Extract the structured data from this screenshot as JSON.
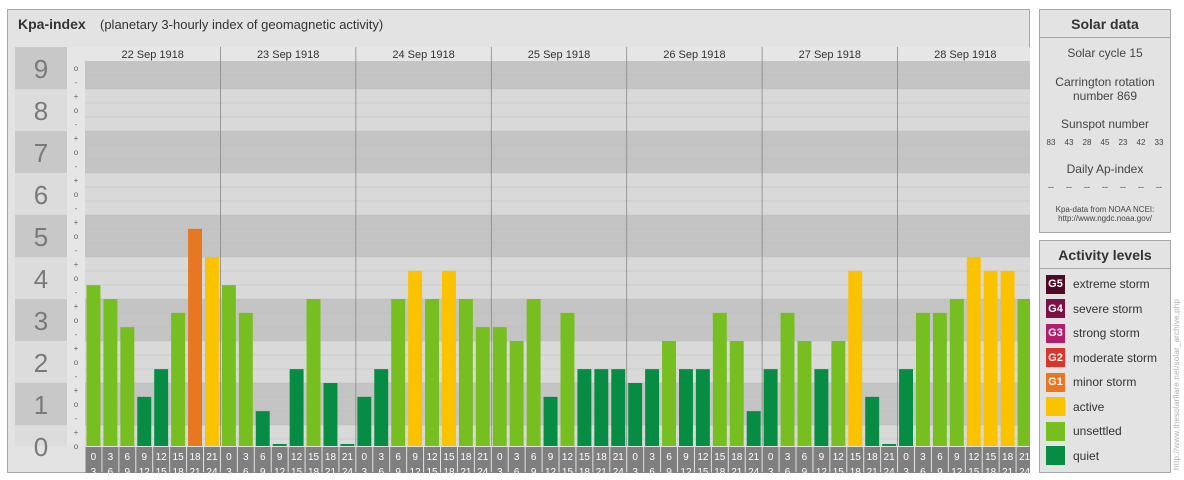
{
  "header": {
    "title": "Kpa-index",
    "subtitle": "(planetary 3-hourly index of geomagnetic activity)"
  },
  "solar": {
    "title": "Solar data",
    "cycle": "Solar cycle 15",
    "carrington_line1": "Carrington rotation",
    "carrington_line2": "number 869",
    "sunspot_label": "Sunspot number",
    "sunspot_values": [
      "83",
      "43",
      "28",
      "45",
      "23",
      "42",
      "33"
    ],
    "ap_label": "Daily Ap-index",
    "ap_values": [
      "--",
      "--",
      "--",
      "--",
      "--",
      "--",
      "--"
    ],
    "source_line1": "Kpa-data from NOAA NCEI:",
    "source_line2": "http://www.ngdc.noaa.gov/"
  },
  "activity": {
    "title": "Activity levels",
    "levels": [
      {
        "badge": "G5",
        "label": "extreme storm",
        "color": "#4d0a26"
      },
      {
        "badge": "G4",
        "label": "severe storm",
        "color": "#7a1248"
      },
      {
        "badge": "G3",
        "label": "strong storm",
        "color": "#b01e6c"
      },
      {
        "badge": "G2",
        "label": "moderate storm",
        "color": "#d9352a"
      },
      {
        "badge": "G1",
        "label": "minor storm",
        "color": "#e87722"
      },
      {
        "badge": "",
        "label": "active",
        "color": "#fbc200"
      },
      {
        "badge": "",
        "label": "unsettled",
        "color": "#77be21"
      },
      {
        "badge": "",
        "label": "quiet",
        "color": "#068c43"
      }
    ]
  },
  "watermark": "http://www.thesolarflare.net/solar_archive.php",
  "chart_data": {
    "type": "bar",
    "title": "Kpa-index",
    "ylim": [
      0,
      9
    ],
    "y_ticks": [
      "0",
      "1",
      "2",
      "3",
      "4",
      "5",
      "6",
      "7",
      "8",
      "9"
    ],
    "sub_ticks": [
      "o",
      "+",
      "-"
    ],
    "days": [
      "22 Sep 1918",
      "23 Sep 1918",
      "24 Sep 1918",
      "25 Sep 1918",
      "26 Sep 1918",
      "27 Sep 1918",
      "28 Sep 1918"
    ],
    "interval_start": [
      "0",
      "3",
      "6",
      "9",
      "12",
      "15",
      "18",
      "21"
    ],
    "interval_end": [
      "3",
      "6",
      "9",
      "12",
      "15",
      "18",
      "21",
      "24"
    ],
    "values": [
      [
        3.33,
        3.0,
        2.33,
        0.67,
        1.33,
        2.67,
        4.67,
        4.0
      ],
      [
        3.33,
        2.67,
        0.33,
        0.0,
        1.33,
        3.0,
        1.0,
        0.0
      ],
      [
        0.67,
        1.33,
        3.0,
        3.67,
        3.0,
        3.67,
        3.0,
        2.33
      ],
      [
        2.33,
        2.0,
        3.0,
        0.67,
        2.67,
        1.33,
        1.33,
        1.33
      ],
      [
        1.0,
        1.33,
        2.0,
        1.33,
        1.33,
        2.67,
        2.0,
        0.33
      ],
      [
        1.33,
        2.67,
        2.0,
        1.33,
        2.0,
        3.67,
        0.67,
        0.0
      ],
      [
        1.33,
        2.67,
        2.67,
        3.0,
        4.0,
        3.67,
        3.67,
        3.0
      ]
    ],
    "level_colors": {
      "quiet": "#068c43",
      "unsettled": "#77be21",
      "active": "#fbc200",
      "minor_storm": "#e87722",
      "grid_band_dark": "#c4c4c4",
      "grid_band_light": "#d9d9d9",
      "tick_box": "#7a7a7a",
      "interval_box": "#7f7f7f"
    }
  }
}
